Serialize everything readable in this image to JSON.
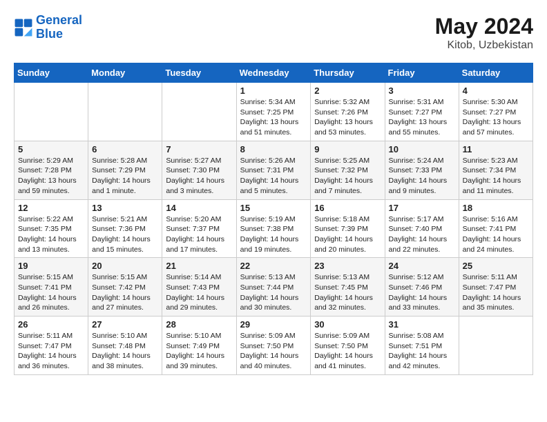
{
  "header": {
    "logo_line1": "General",
    "logo_line2": "Blue",
    "month_year": "May 2024",
    "location": "Kitob, Uzbekistan"
  },
  "days_of_week": [
    "Sunday",
    "Monday",
    "Tuesday",
    "Wednesday",
    "Thursday",
    "Friday",
    "Saturday"
  ],
  "weeks": [
    [
      {
        "day": "",
        "sunrise": "",
        "sunset": "",
        "daylight": ""
      },
      {
        "day": "",
        "sunrise": "",
        "sunset": "",
        "daylight": ""
      },
      {
        "day": "",
        "sunrise": "",
        "sunset": "",
        "daylight": ""
      },
      {
        "day": "1",
        "sunrise": "Sunrise: 5:34 AM",
        "sunset": "Sunset: 7:25 PM",
        "daylight": "Daylight: 13 hours and 51 minutes."
      },
      {
        "day": "2",
        "sunrise": "Sunrise: 5:32 AM",
        "sunset": "Sunset: 7:26 PM",
        "daylight": "Daylight: 13 hours and 53 minutes."
      },
      {
        "day": "3",
        "sunrise": "Sunrise: 5:31 AM",
        "sunset": "Sunset: 7:27 PM",
        "daylight": "Daylight: 13 hours and 55 minutes."
      },
      {
        "day": "4",
        "sunrise": "Sunrise: 5:30 AM",
        "sunset": "Sunset: 7:27 PM",
        "daylight": "Daylight: 13 hours and 57 minutes."
      }
    ],
    [
      {
        "day": "5",
        "sunrise": "Sunrise: 5:29 AM",
        "sunset": "Sunset: 7:28 PM",
        "daylight": "Daylight: 13 hours and 59 minutes."
      },
      {
        "day": "6",
        "sunrise": "Sunrise: 5:28 AM",
        "sunset": "Sunset: 7:29 PM",
        "daylight": "Daylight: 14 hours and 1 minute."
      },
      {
        "day": "7",
        "sunrise": "Sunrise: 5:27 AM",
        "sunset": "Sunset: 7:30 PM",
        "daylight": "Daylight: 14 hours and 3 minutes."
      },
      {
        "day": "8",
        "sunrise": "Sunrise: 5:26 AM",
        "sunset": "Sunset: 7:31 PM",
        "daylight": "Daylight: 14 hours and 5 minutes."
      },
      {
        "day": "9",
        "sunrise": "Sunrise: 5:25 AM",
        "sunset": "Sunset: 7:32 PM",
        "daylight": "Daylight: 14 hours and 7 minutes."
      },
      {
        "day": "10",
        "sunrise": "Sunrise: 5:24 AM",
        "sunset": "Sunset: 7:33 PM",
        "daylight": "Daylight: 14 hours and 9 minutes."
      },
      {
        "day": "11",
        "sunrise": "Sunrise: 5:23 AM",
        "sunset": "Sunset: 7:34 PM",
        "daylight": "Daylight: 14 hours and 11 minutes."
      }
    ],
    [
      {
        "day": "12",
        "sunrise": "Sunrise: 5:22 AM",
        "sunset": "Sunset: 7:35 PM",
        "daylight": "Daylight: 14 hours and 13 minutes."
      },
      {
        "day": "13",
        "sunrise": "Sunrise: 5:21 AM",
        "sunset": "Sunset: 7:36 PM",
        "daylight": "Daylight: 14 hours and 15 minutes."
      },
      {
        "day": "14",
        "sunrise": "Sunrise: 5:20 AM",
        "sunset": "Sunset: 7:37 PM",
        "daylight": "Daylight: 14 hours and 17 minutes."
      },
      {
        "day": "15",
        "sunrise": "Sunrise: 5:19 AM",
        "sunset": "Sunset: 7:38 PM",
        "daylight": "Daylight: 14 hours and 19 minutes."
      },
      {
        "day": "16",
        "sunrise": "Sunrise: 5:18 AM",
        "sunset": "Sunset: 7:39 PM",
        "daylight": "Daylight: 14 hours and 20 minutes."
      },
      {
        "day": "17",
        "sunrise": "Sunrise: 5:17 AM",
        "sunset": "Sunset: 7:40 PM",
        "daylight": "Daylight: 14 hours and 22 minutes."
      },
      {
        "day": "18",
        "sunrise": "Sunrise: 5:16 AM",
        "sunset": "Sunset: 7:41 PM",
        "daylight": "Daylight: 14 hours and 24 minutes."
      }
    ],
    [
      {
        "day": "19",
        "sunrise": "Sunrise: 5:15 AM",
        "sunset": "Sunset: 7:41 PM",
        "daylight": "Daylight: 14 hours and 26 minutes."
      },
      {
        "day": "20",
        "sunrise": "Sunrise: 5:15 AM",
        "sunset": "Sunset: 7:42 PM",
        "daylight": "Daylight: 14 hours and 27 minutes."
      },
      {
        "day": "21",
        "sunrise": "Sunrise: 5:14 AM",
        "sunset": "Sunset: 7:43 PM",
        "daylight": "Daylight: 14 hours and 29 minutes."
      },
      {
        "day": "22",
        "sunrise": "Sunrise: 5:13 AM",
        "sunset": "Sunset: 7:44 PM",
        "daylight": "Daylight: 14 hours and 30 minutes."
      },
      {
        "day": "23",
        "sunrise": "Sunrise: 5:13 AM",
        "sunset": "Sunset: 7:45 PM",
        "daylight": "Daylight: 14 hours and 32 minutes."
      },
      {
        "day": "24",
        "sunrise": "Sunrise: 5:12 AM",
        "sunset": "Sunset: 7:46 PM",
        "daylight": "Daylight: 14 hours and 33 minutes."
      },
      {
        "day": "25",
        "sunrise": "Sunrise: 5:11 AM",
        "sunset": "Sunset: 7:47 PM",
        "daylight": "Daylight: 14 hours and 35 minutes."
      }
    ],
    [
      {
        "day": "26",
        "sunrise": "Sunrise: 5:11 AM",
        "sunset": "Sunset: 7:47 PM",
        "daylight": "Daylight: 14 hours and 36 minutes."
      },
      {
        "day": "27",
        "sunrise": "Sunrise: 5:10 AM",
        "sunset": "Sunset: 7:48 PM",
        "daylight": "Daylight: 14 hours and 38 minutes."
      },
      {
        "day": "28",
        "sunrise": "Sunrise: 5:10 AM",
        "sunset": "Sunset: 7:49 PM",
        "daylight": "Daylight: 14 hours and 39 minutes."
      },
      {
        "day": "29",
        "sunrise": "Sunrise: 5:09 AM",
        "sunset": "Sunset: 7:50 PM",
        "daylight": "Daylight: 14 hours and 40 minutes."
      },
      {
        "day": "30",
        "sunrise": "Sunrise: 5:09 AM",
        "sunset": "Sunset: 7:50 PM",
        "daylight": "Daylight: 14 hours and 41 minutes."
      },
      {
        "day": "31",
        "sunrise": "Sunrise: 5:08 AM",
        "sunset": "Sunset: 7:51 PM",
        "daylight": "Daylight: 14 hours and 42 minutes."
      },
      {
        "day": "",
        "sunrise": "",
        "sunset": "",
        "daylight": ""
      }
    ]
  ]
}
